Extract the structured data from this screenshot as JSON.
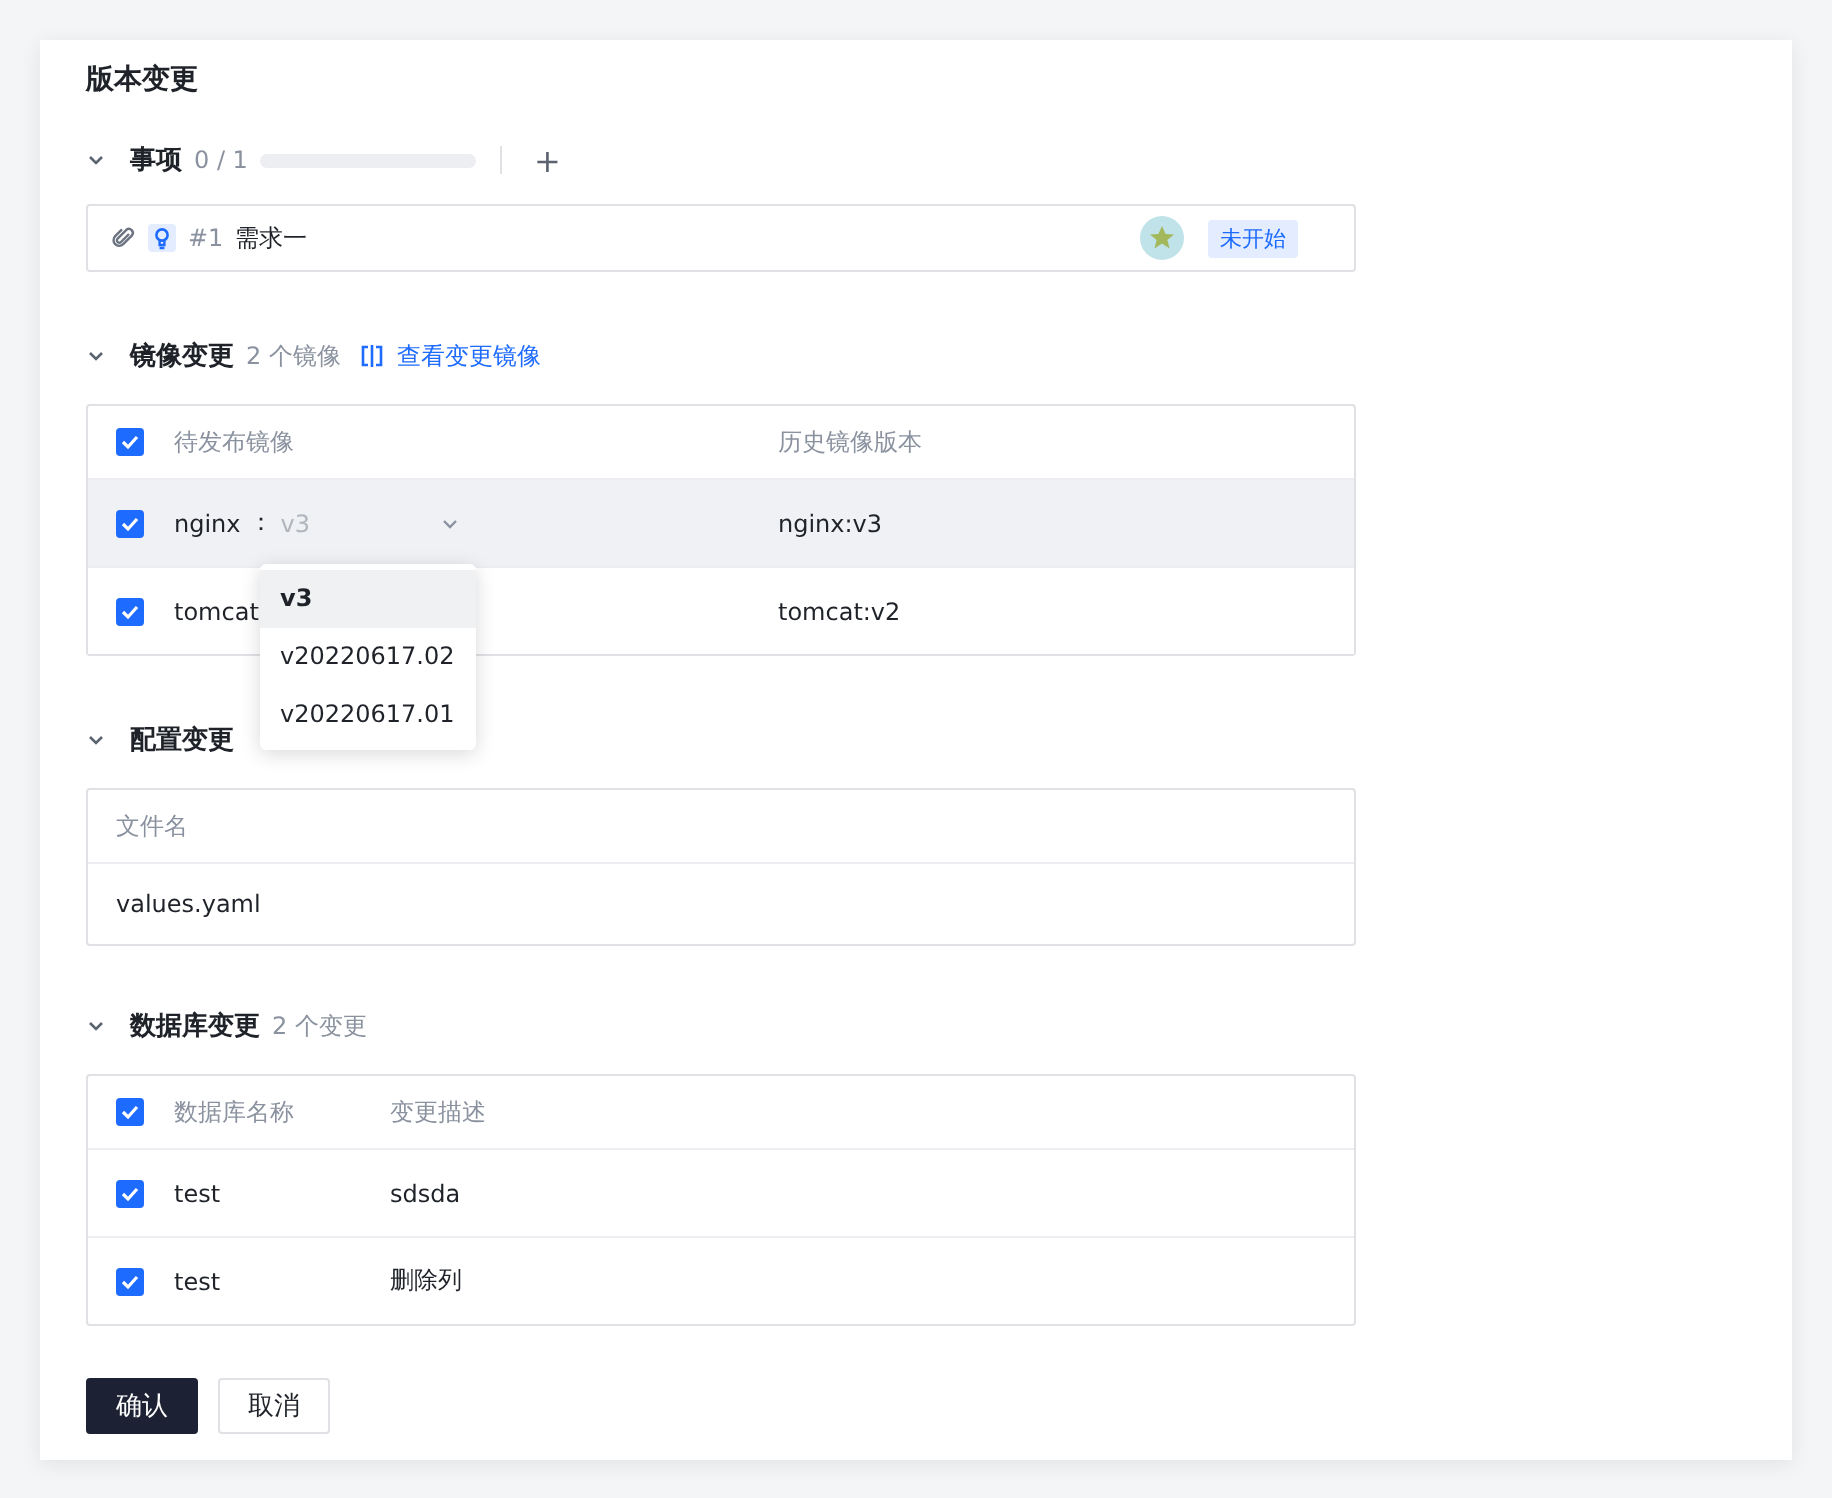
{
  "title": "版本变更",
  "items_section": {
    "title": "事项",
    "expanded": true,
    "count": "0 / 1",
    "level": 0,
    "add": "+",
    "items": [
      {
        "number": "#1",
        "name": "需求一",
        "status": "未开始"
      }
    ]
  },
  "image_section": {
    "title": "镜像变更",
    "expanded": true,
    "count": "2 个镜像",
    "link": "查看变更镜像",
    "columns": [
      "待发布镜像",
      "历史镜像版本"
    ],
    "all_checked": true,
    "rows": [
      {
        "checked": true,
        "name": "nginx",
        "separator": "：",
        "version": "v3",
        "history": "nginx:v3",
        "hovered": true
      },
      {
        "checked": true,
        "name": "tomcat",
        "history": "tomcat:v2",
        "hovered": false
      }
    ],
    "dropdown": {
      "options": [
        {
          "label": "v3",
          "selected": true
        },
        {
          "label": "v20220617.02",
          "selected": false
        },
        {
          "label": "v20220617.01",
          "selected": false
        }
      ]
    }
  },
  "config_section": {
    "title": "配置变更",
    "expanded": true,
    "columns": [
      "文件名"
    ],
    "rows": [
      "values.yaml"
    ]
  },
  "db_section": {
    "title": "数据库变更",
    "expanded": true,
    "count": "2 个变更",
    "columns": [
      "数据库名称",
      "变更描述"
    ],
    "all_checked": true,
    "rows": [
      {
        "checked": true,
        "name": "test",
        "description": "sdsda"
      },
      {
        "checked": true,
        "name": "test",
        "description": "删除列"
      }
    ]
  },
  "buttons": [
    {
      "label": "确认",
      "kind": "primary"
    },
    {
      "label": "取消",
      "kind": "secondary"
    }
  ]
}
